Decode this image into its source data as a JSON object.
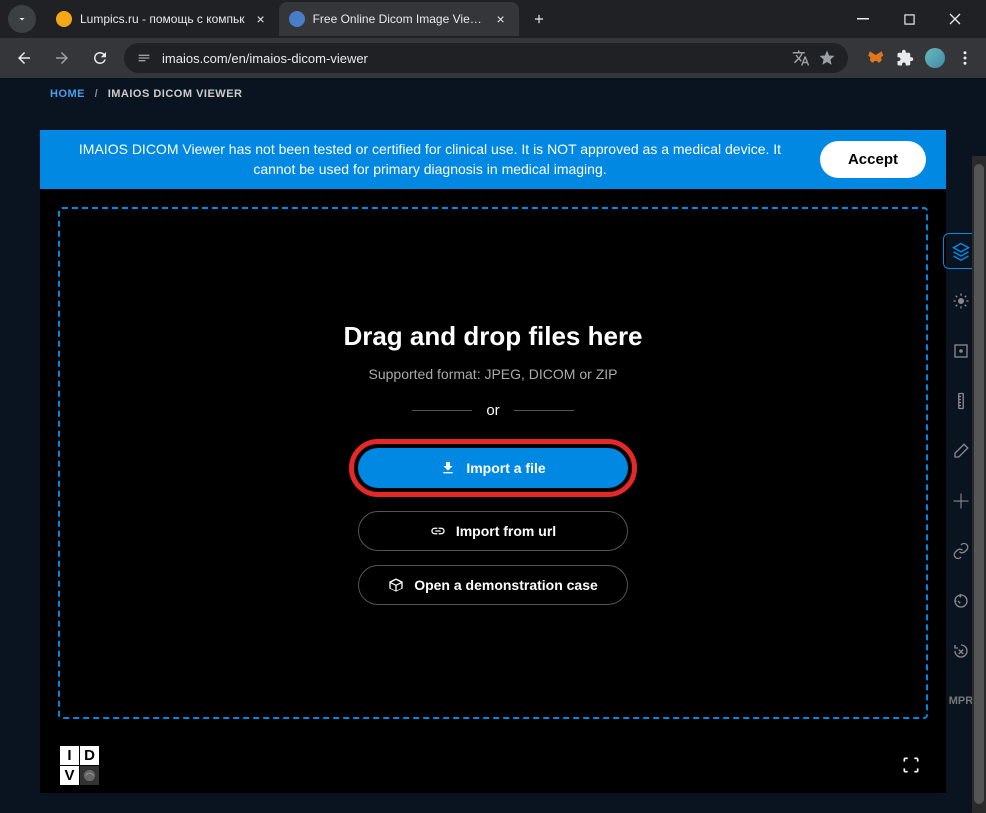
{
  "browser": {
    "tabs": [
      {
        "title": "Lumpics.ru - помощь с компьк",
        "active": false,
        "favicon": "#f4a817"
      },
      {
        "title": "Free Online Dicom Image Viewe",
        "active": true,
        "favicon": "#4a7dc9"
      }
    ],
    "url": "imaios.com/en/imaios-dicom-viewer"
  },
  "breadcrumb": {
    "home": "HOME",
    "current": "IMAIOS DICOM VIEWER"
  },
  "banner": {
    "text": "IMAIOS DICOM Viewer has not been tested or certified for clinical use. It is NOT approved as a medical device. It cannot be used for primary diagnosis in medical imaging.",
    "accept": "Accept"
  },
  "drop": {
    "title": "Drag and drop files here",
    "sub": "Supported format: JPEG, DICOM or ZIP",
    "or": "or",
    "import_file": "Import a file",
    "import_url": "Import from url",
    "demo": "Open a demonstration case"
  },
  "tools": {
    "mpr": "MPR"
  }
}
